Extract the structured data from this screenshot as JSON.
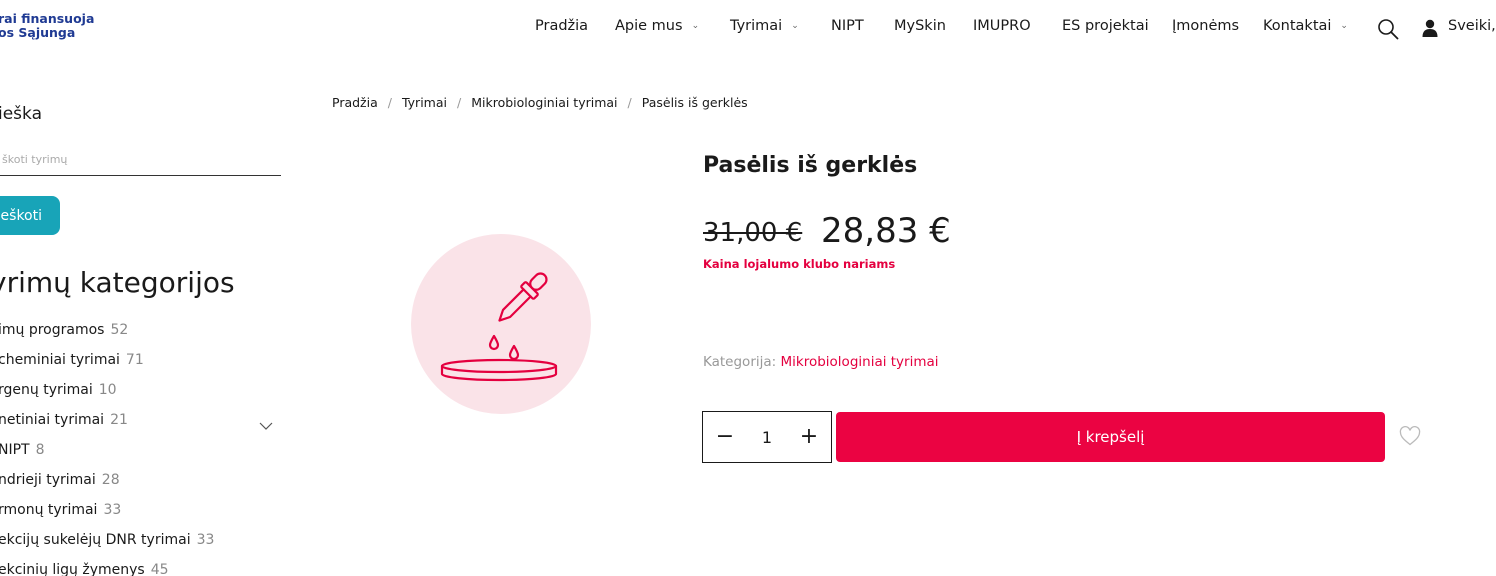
{
  "header": {
    "logo_line1": "rai finansuoja",
    "logo_line2": "os Sąjunga",
    "nav": [
      {
        "label": "Pradžia",
        "has_dropdown": false
      },
      {
        "label": "Apie mus",
        "has_dropdown": true
      },
      {
        "label": "Tyrimai",
        "has_dropdown": true
      },
      {
        "label": "NIPT",
        "has_dropdown": false
      },
      {
        "label": "MySkin",
        "has_dropdown": false
      },
      {
        "label": "IMUPRO",
        "has_dropdown": false
      },
      {
        "label": "ES projektai",
        "has_dropdown": false
      },
      {
        "label": "Įmonėms",
        "has_dropdown": false
      },
      {
        "label": "Kontaktai",
        "has_dropdown": true
      }
    ],
    "user_greeting": "Sveiki, A",
    "icons": {
      "search": "search-icon",
      "user": "user-icon"
    }
  },
  "sidebar": {
    "search_title": "ieška",
    "search_placeholder": "škoti tyrimų",
    "search_button": "eškoti",
    "categories_title": "yrimų kategorijos",
    "categories": [
      {
        "label": "imų programos",
        "count": "52"
      },
      {
        "label": "cheminiai tyrimai",
        "count": "71"
      },
      {
        "label": "rgenų tyrimai",
        "count": "10"
      },
      {
        "label": "netiniai tyrimai",
        "count": "21"
      },
      {
        "label": "NIPT",
        "count": "8"
      },
      {
        "label": "ndrieji tyrimai",
        "count": "28"
      },
      {
        "label": "rmonų tyrimai",
        "count": "33"
      },
      {
        "label": "ekcijų sukelėjų DNR tyrimai",
        "count": "33"
      },
      {
        "label": "ekcinių ligų žymenys",
        "count": "45"
      }
    ]
  },
  "breadcrumb": [
    "Pradžia",
    "Tyrimai",
    "Mikrobiologiniai tyrimai",
    "Pasėlis iš gerklės"
  ],
  "product": {
    "title": "Pasėlis iš gerklės",
    "price_old": "31,00 €",
    "price_new": "28,83 €",
    "loyalty_note": "Kaina lojalumo klubo nariams",
    "category_label": "Kategorija:",
    "category_value": "Mikrobiologiniai tyrimai",
    "quantity": "1",
    "qty_minus": "−",
    "qty_plus": "+",
    "add_to_cart": "Į krepšelį",
    "icon": "pipette-petri-dish-icon",
    "wishlist_icon": "heart-icon"
  },
  "colors": {
    "accent": "#eb0342",
    "loyalty_text": "#e4003f",
    "search_button": "#18a4b8",
    "product_circle": "#fae3e8",
    "logo": "#1f3a93"
  }
}
